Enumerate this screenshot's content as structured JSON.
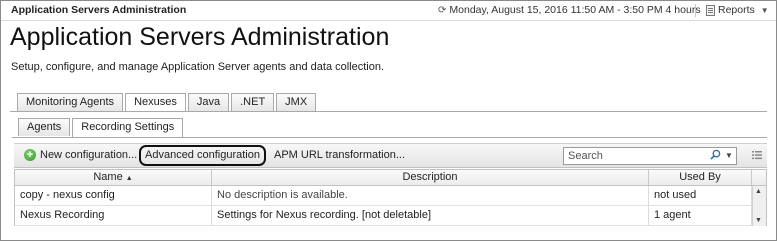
{
  "topbar": {
    "breadcrumb": "Application Servers Administration",
    "timerange": "Monday, August 15, 2016 11:50 AM - 3:50 PM 4 hours",
    "reports_label": "Reports"
  },
  "page": {
    "title": "Application Servers Administration",
    "subtitle": "Setup, configure, and manage Application Server agents and data collection."
  },
  "main_tabs": [
    {
      "label": "Monitoring Agents",
      "active": false
    },
    {
      "label": "Nexuses",
      "active": true
    },
    {
      "label": "Java",
      "active": false
    },
    {
      "label": ".NET",
      "active": false
    },
    {
      "label": "JMX",
      "active": false
    }
  ],
  "sub_tabs": [
    {
      "label": "Agents",
      "active": false
    },
    {
      "label": "Recording Settings",
      "active": true
    }
  ],
  "toolbar": {
    "new_config_label": "New configuration...",
    "advanced_config_label": "Advanced configuration",
    "apm_url_label": "APM URL transformation...",
    "search_placeholder": "Search"
  },
  "table": {
    "columns": [
      "Name",
      "Description",
      "Used By"
    ],
    "sort_column": "Name",
    "rows": [
      {
        "name": "copy - nexus config",
        "description": "No description is available.",
        "used_by": "not used"
      },
      {
        "name": "Nexus Recording",
        "description": "Settings for Nexus recording. [not deletable]",
        "used_by": "1 agent"
      }
    ]
  },
  "colors": {
    "accent_green": "#2f9a24",
    "border": "#a9a9a9"
  }
}
